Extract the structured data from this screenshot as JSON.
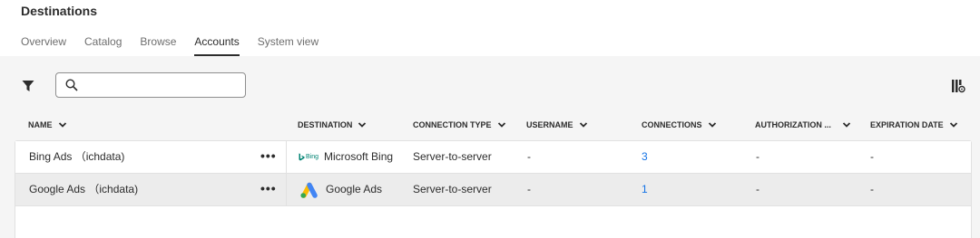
{
  "page": {
    "title": "Destinations"
  },
  "tabs": [
    {
      "label": "Overview"
    },
    {
      "label": "Catalog"
    },
    {
      "label": "Browse"
    },
    {
      "label": "Accounts"
    },
    {
      "label": "System view"
    }
  ],
  "active_tab": "Accounts",
  "search": {
    "value": "",
    "placeholder": ""
  },
  "icons": {
    "filter": "filter-icon",
    "search": "search-icon",
    "column_settings": "column-settings-icon",
    "more": "more-actions-icon",
    "chevron": "chevron-down-icon"
  },
  "colors": {
    "link": "#1473e6",
    "selected_row": "#ececec",
    "bing": "#008373"
  },
  "table": {
    "columns": [
      {
        "label": "NAME"
      },
      {
        "label": "DESTINATION"
      },
      {
        "label": "CONNECTION TYPE"
      },
      {
        "label": "USERNAME"
      },
      {
        "label": "CONNECTIONS"
      },
      {
        "label": "AUTHORIZATION ..."
      },
      {
        "label": "EXPIRATION DATE"
      }
    ],
    "rows": [
      {
        "name": "Bing Ads （ichdata)",
        "more": "•••",
        "destination_logo_text": "Bing",
        "destination": "Microsoft Bing",
        "connection_type": "Server-to-server",
        "username": "-",
        "connections": "3",
        "authorization": "-",
        "expiration_date": "-"
      },
      {
        "name": "Google Ads （ichdata)",
        "more": "•••",
        "destination": "Google Ads",
        "connection_type": "Server-to-server",
        "username": "-",
        "connections": "1",
        "authorization": "-",
        "expiration_date": "-"
      }
    ]
  }
}
